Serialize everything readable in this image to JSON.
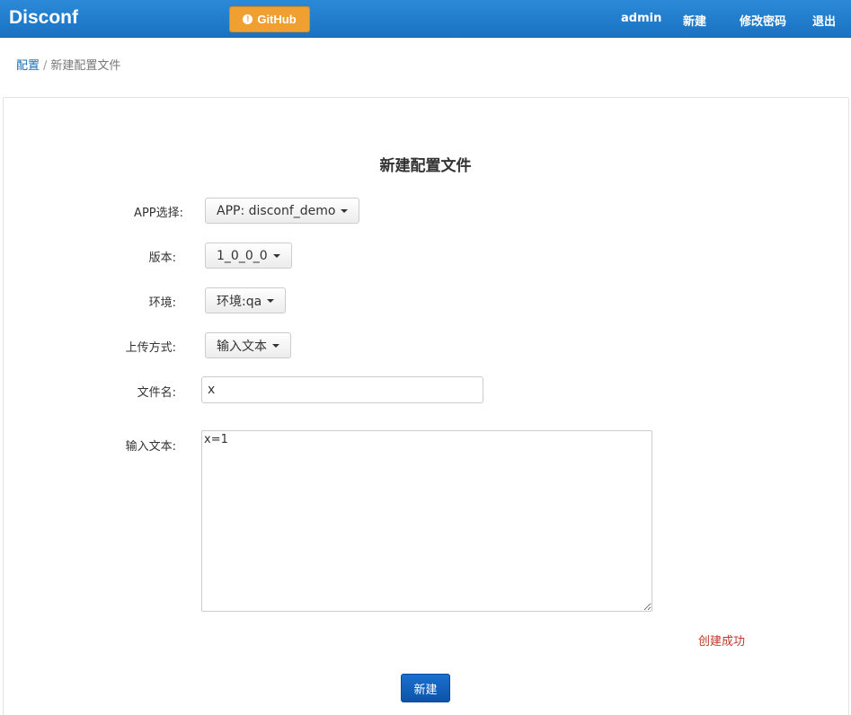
{
  "header": {
    "brand": "Disconf",
    "github_label": "GitHub",
    "github_icon": "info-circle-icon",
    "nav": {
      "user": "admin",
      "new": "新建",
      "change_password": "修改密码",
      "logout": "退出"
    },
    "colors": {
      "bar": "#1a72c2",
      "github_button": "#f0a030"
    }
  },
  "breadcrumb": {
    "root": "配置",
    "separator": "/",
    "current": "新建配置文件"
  },
  "form": {
    "title": "新建配置文件",
    "app_label": "APP选择:",
    "app_value": "APP: disconf_demo",
    "version_label": "版本:",
    "version_value": "1_0_0_0",
    "env_label": "环境:",
    "env_value": "环境:qa",
    "upload_label": "上传方式:",
    "upload_value": "输入文本",
    "filename_label": "文件名:",
    "filename_value": "x",
    "text_label": "输入文本:",
    "text_value": "x=1",
    "status_message": "创建成功",
    "submit_label": "新建"
  }
}
